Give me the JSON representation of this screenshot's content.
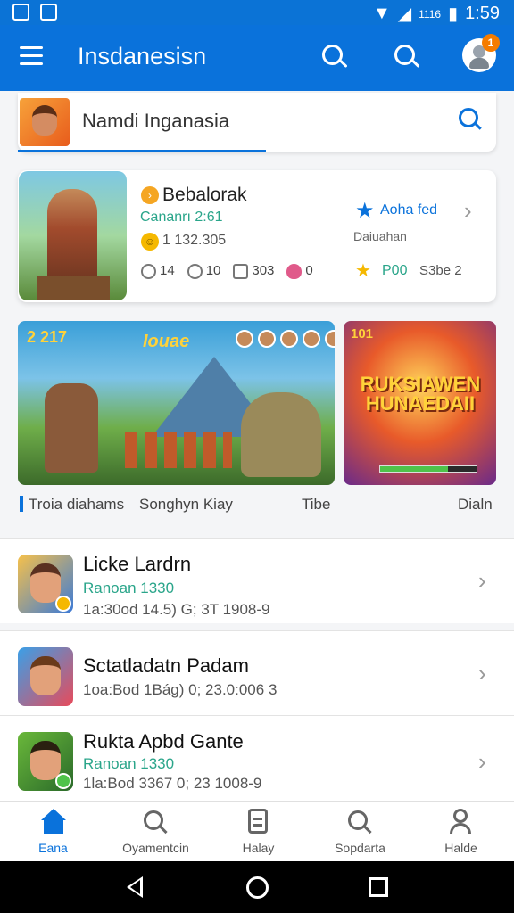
{
  "status_bar": {
    "network": "1116",
    "time": "1:59"
  },
  "app_bar": {
    "title": "Insdanesisn",
    "notification_count": "1"
  },
  "search": {
    "value": "Namdi Inganasia"
  },
  "featured": {
    "title": "Bebalorak",
    "subtitle": "Cananrı 2:61",
    "count": "1 132.305",
    "stats": [
      "14",
      "10",
      "303",
      "0"
    ],
    "link_label": "Aoha fed",
    "note": "Daiuahan",
    "price": "P00",
    "extra": "S3be 2"
  },
  "banners": {
    "main": {
      "score": "2 217",
      "logo": "Iouae"
    },
    "side": {
      "score": "101",
      "logo": "RUKSIAWEN HUNAEDAII"
    }
  },
  "captions": [
    "Troia diahams",
    "Songhyn Kiay",
    "Tibe",
    "Dialn"
  ],
  "list": [
    {
      "title": "Licke Lardrn",
      "subtitle": "Ranoan 1330",
      "meta": "1a:30od 14.5) G; 3T 1908-9"
    },
    {
      "title": "Sctatladatn Padam",
      "subtitle": "",
      "meta": "1oa:Bod 1Bág) 0; 23.0:006 3"
    },
    {
      "title": "Rukta Apbd Gante",
      "subtitle": "Ranoan 1330",
      "meta": "1la:Bod 3367 0; 23 1008-9"
    }
  ],
  "bottom_nav": [
    "Eana",
    "Oyamentcin",
    "Halay",
    "Sopdarta",
    "Halde"
  ],
  "colors": {
    "primary": "#0a72db",
    "accent_green": "#2aa58a",
    "badge": "#f57c00"
  }
}
